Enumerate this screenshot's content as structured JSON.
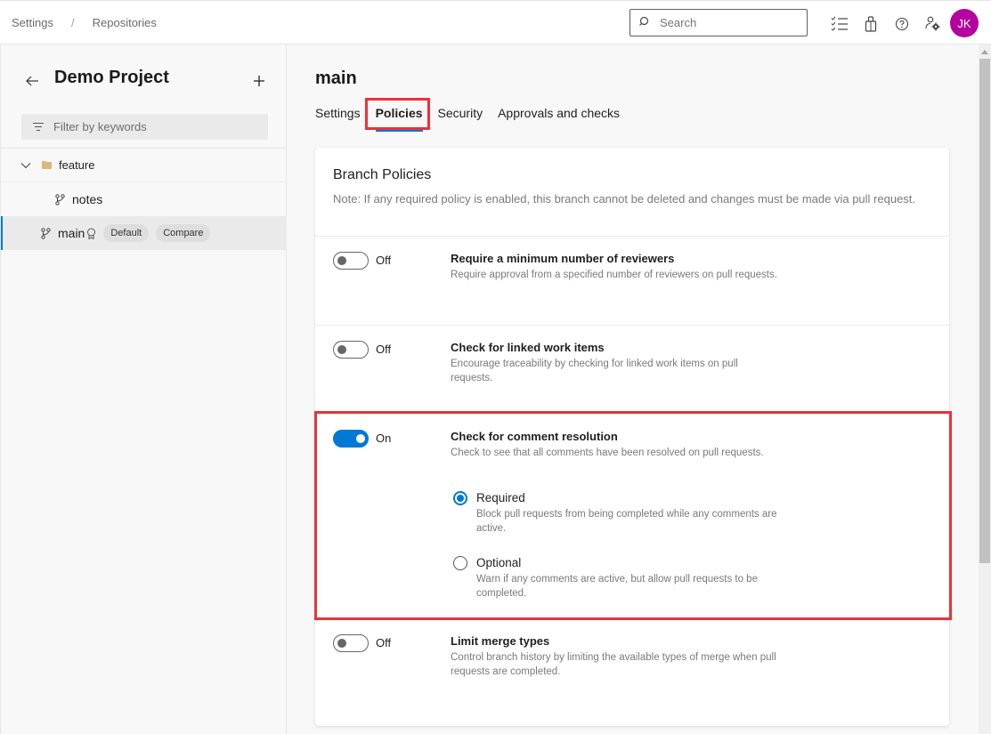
{
  "header": {
    "breadcrumb": [
      {
        "label": "Settings"
      },
      {
        "label": "Repositories"
      }
    ],
    "breadcrumb_separator": "/",
    "search_placeholder": "Search",
    "icons": [
      "work-items-checklist-icon",
      "marketplace-bag-icon",
      "help-icon",
      "user-settings-icon"
    ],
    "avatar_initials": "JK",
    "avatar_color": "#b4009e"
  },
  "sidebar": {
    "project_name": "Demo Project",
    "add_label": "+",
    "filter_placeholder": "Filter by keywords",
    "tree": [
      {
        "type": "folder",
        "label": "feature",
        "expanded": true
      },
      {
        "type": "branch",
        "label": "notes",
        "indent": 1
      },
      {
        "type": "branch",
        "label": "main",
        "selected": true,
        "badges": [
          "Default",
          "Compare"
        ]
      }
    ]
  },
  "main": {
    "branch_name": "main",
    "tabs": [
      {
        "label": "Settings",
        "active": false
      },
      {
        "label": "Policies",
        "active": true
      },
      {
        "label": "Security",
        "active": false
      },
      {
        "label": "Approvals and checks",
        "active": false
      }
    ],
    "card": {
      "title": "Branch Policies",
      "note": "Note: If any required policy is enabled, this branch cannot be deleted and changes must be made via pull request.",
      "policies": [
        {
          "state": "Off",
          "enabled": false,
          "title": "Require a minimum number of reviewers",
          "description": "Require approval from a specified number of reviewers on pull requests."
        },
        {
          "state": "Off",
          "enabled": false,
          "title": "Check for linked work items",
          "description": "Encourage traceability by checking for linked work items on pull requests."
        },
        {
          "state": "On",
          "enabled": true,
          "title": "Check for comment resolution",
          "description": "Check to see that all comments have been resolved on pull requests.",
          "options": [
            {
              "label": "Required",
              "description": "Block pull requests from being completed while any comments are active.",
              "checked": true
            },
            {
              "label": "Optional",
              "description": "Warn if any comments are active, but allow pull requests to be completed.",
              "checked": false
            }
          ]
        },
        {
          "state": "Off",
          "enabled": false,
          "title": "Limit merge types",
          "description": "Control branch history by limiting the available types of merge when pull requests are completed."
        }
      ]
    }
  },
  "colors": {
    "accent": "#0078d4",
    "highlight": "#e8333b"
  }
}
